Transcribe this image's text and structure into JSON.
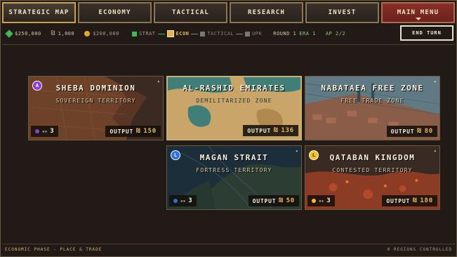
{
  "nav": {
    "tabs": [
      {
        "label": "Strategic Map"
      },
      {
        "label": "Economy"
      },
      {
        "label": "Tactical"
      },
      {
        "label": "Research"
      },
      {
        "label": "Invest"
      },
      {
        "label": "Main Menu"
      }
    ]
  },
  "resources": {
    "money": "$250,000",
    "shekel_amount": "1,000",
    "shekel_symbol": "₪",
    "gold": "$200,000",
    "phases": [
      "STRAT",
      "ECON",
      "TACTICAL",
      "UPK"
    ],
    "round_label": "ROUND 1",
    "era_label": "ERA 1",
    "ap_label": "AP 2/2"
  },
  "end_turn_label": "END TURN",
  "cards": [
    {
      "badge": "A",
      "title": "SHEBA DOMINION",
      "subtitle": "SOVEREIGN TERRITORY",
      "troops": "3",
      "output_label": "OUTPUT",
      "output_symbol": "₪",
      "output_value": "150"
    },
    {
      "title": "AL-RASHID EMIRATES",
      "subtitle": "DEMILITARIZED ZONE",
      "output_label": "OUTPUT",
      "output_symbol": "₪",
      "output_value": "136"
    },
    {
      "title": "NABATAEA FREE ZONE",
      "subtitle": "FREE TRADE ZONE",
      "output_label": "OUTPUT",
      "output_symbol": "₪",
      "output_value": "80"
    },
    {
      "badge": "L",
      "title": "MAGAN STRAIT",
      "subtitle": "FORTRESS TERRITORY",
      "troops": "3",
      "output_label": "OUTPUT",
      "output_symbol": "₪",
      "output_value": "50"
    },
    {
      "badge": "L",
      "title": "QATABAN KINGDOM",
      "subtitle": "CONTESTED TERRITORY",
      "troops": "3",
      "output_label": "OUTPUT",
      "output_symbol": "₪",
      "output_value": "180"
    }
  ],
  "footer": {
    "left": "ECONOMIC PHASE - PLACE & TRADE",
    "right": "0 REGIONS CONTROLLED"
  },
  "colors": {
    "accent": "#c9a24d",
    "menu_red": "#8a2f29",
    "purple": "#8b3fd9",
    "blue": "#2f6fe0",
    "yellow": "#f0c419"
  }
}
